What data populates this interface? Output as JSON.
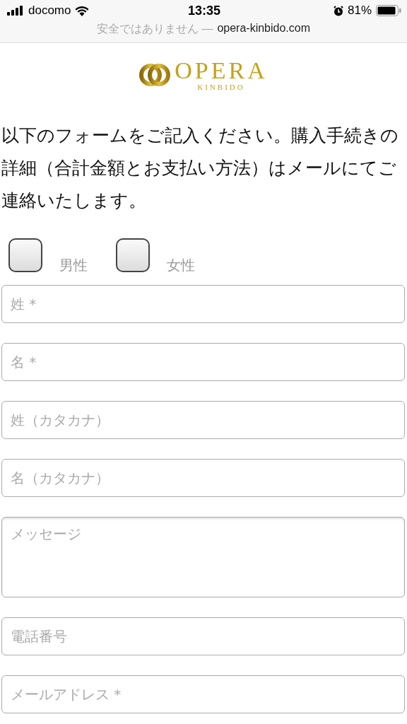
{
  "status_bar": {
    "carrier": "docomo",
    "time": "13:35",
    "battery": "81%"
  },
  "address_bar": {
    "security": "安全ではありません —",
    "domain": "opera-kinbido.com"
  },
  "logo": {
    "name": "OPERA",
    "sub": "KINBIDO"
  },
  "intro": "以下のフォームをご記入ください。購入手続きの詳細（合計金額とお支払い方法）はメールにてご連絡いたします。",
  "gender": [
    {
      "label": "男性",
      "checked": false
    },
    {
      "label": "女性",
      "checked": false
    }
  ],
  "fields": [
    {
      "kind": "input",
      "placeholder": "姓 *"
    },
    {
      "kind": "input",
      "placeholder": "名 *"
    },
    {
      "kind": "input",
      "placeholder": "姓（カタカナ）"
    },
    {
      "kind": "input",
      "placeholder": "名（カタカナ）"
    },
    {
      "kind": "textarea",
      "placeholder": "メッセージ"
    },
    {
      "kind": "input",
      "placeholder": "電話番号"
    },
    {
      "kind": "input",
      "placeholder": "メールアドレス *"
    }
  ]
}
